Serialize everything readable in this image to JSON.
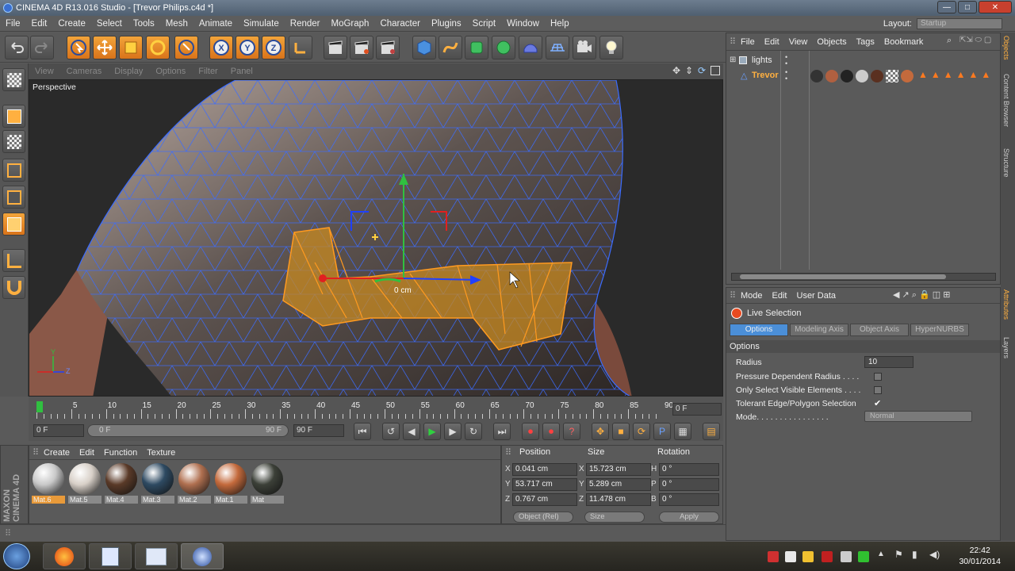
{
  "titlebar": {
    "title": "CINEMA 4D R13.016 Studio - [Trevor Philips.c4d *]"
  },
  "menubar": {
    "items": [
      "File",
      "Edit",
      "Create",
      "Select",
      "Tools",
      "Mesh",
      "Animate",
      "Simulate",
      "Render",
      "MoGraph",
      "Character",
      "Plugins",
      "Script",
      "Window",
      "Help"
    ],
    "layout_label": "Layout:",
    "layout_value": "Startup"
  },
  "viewport": {
    "menu": [
      "View",
      "Cameras",
      "Display",
      "Options",
      "Filter",
      "Panel"
    ],
    "label": "Perspective",
    "distance_label": "0 cm",
    "axis_y": "Y",
    "axis_z": "Z"
  },
  "timeline": {
    "ticks": [
      "0",
      "5",
      "10",
      "15",
      "20",
      "25",
      "30",
      "35",
      "40",
      "45",
      "50",
      "55",
      "60",
      "65",
      "70",
      "75",
      "80",
      "85",
      "90"
    ],
    "current_frame": "0 F"
  },
  "playbar": {
    "start": "0 F",
    "range_start": "0 F",
    "range_end": "90 F",
    "end": "90 F"
  },
  "materials": {
    "menu": [
      "Create",
      "Edit",
      "Function",
      "Texture"
    ],
    "items": [
      {
        "name": "Mat.6",
        "color": "#c9c9c9",
        "selected": true
      },
      {
        "name": "Mat.5",
        "color": "#d8d0c8",
        "selected": false
      },
      {
        "name": "Mat.4",
        "color": "#5a3a28",
        "selected": false
      },
      {
        "name": "Mat.3",
        "color": "#2e4a62",
        "selected": false
      },
      {
        "name": "Mat.2",
        "color": "#b07050",
        "selected": false
      },
      {
        "name": "Mat.1",
        "color": "#c46a3c",
        "selected": false
      },
      {
        "name": "Mat",
        "color": "#3c4038",
        "selected": false
      }
    ]
  },
  "coordinates": {
    "headers": [
      "Position",
      "Size",
      "Rotation"
    ],
    "rows": [
      {
        "axis": "X",
        "pos": "0.041 cm",
        "size_axis": "X",
        "size": "15.723 cm",
        "rot_axis": "H",
        "rot": "0 °"
      },
      {
        "axis": "Y",
        "pos": "53.717 cm",
        "size_axis": "Y",
        "size": "5.289 cm",
        "rot_axis": "P",
        "rot": "0 °"
      },
      {
        "axis": "Z",
        "pos": "0.767 cm",
        "size_axis": "Z",
        "size": "11.478 cm",
        "rot_axis": "B",
        "rot": "0 °"
      }
    ],
    "mode": "Object (Rel)",
    "size_mode": "Size",
    "apply": "Apply"
  },
  "objects": {
    "menu": [
      "File",
      "Edit",
      "View",
      "Objects",
      "Tags",
      "Bookmark"
    ],
    "items": [
      {
        "name": "lights"
      },
      {
        "name": "Trevor"
      }
    ]
  },
  "attributes": {
    "menu": [
      "Mode",
      "Edit",
      "User Data"
    ],
    "tool": "Live Selection",
    "tabs": [
      "Options",
      "Modeling Axis",
      "Object Axis",
      "HyperNURBS"
    ],
    "section": "Options",
    "radius_label": "Radius",
    "radius": "10",
    "pressure_label": "Pressure Dependent Radius . . . .",
    "visible_label": "Only Select Visible Elements . . . .",
    "tolerant_label": "Tolerant Edge/Polygon Selection",
    "tolerant_check": "✔",
    "mode_label": "Mode. . . . . . . . . . . . . . . .",
    "mode_value": "Normal"
  },
  "righttabs": [
    "Objects",
    "Content Browser",
    "Structure",
    "Attributes",
    "Layers"
  ],
  "logo": {
    "line1": "MAXON",
    "line2": "CINEMA 4D"
  },
  "clock": {
    "time": "22:42",
    "date": "30/01/2014"
  },
  "colors": {
    "accent": "#e8862a",
    "selection": "#4b8fd8",
    "wire": "#3b6cff"
  }
}
